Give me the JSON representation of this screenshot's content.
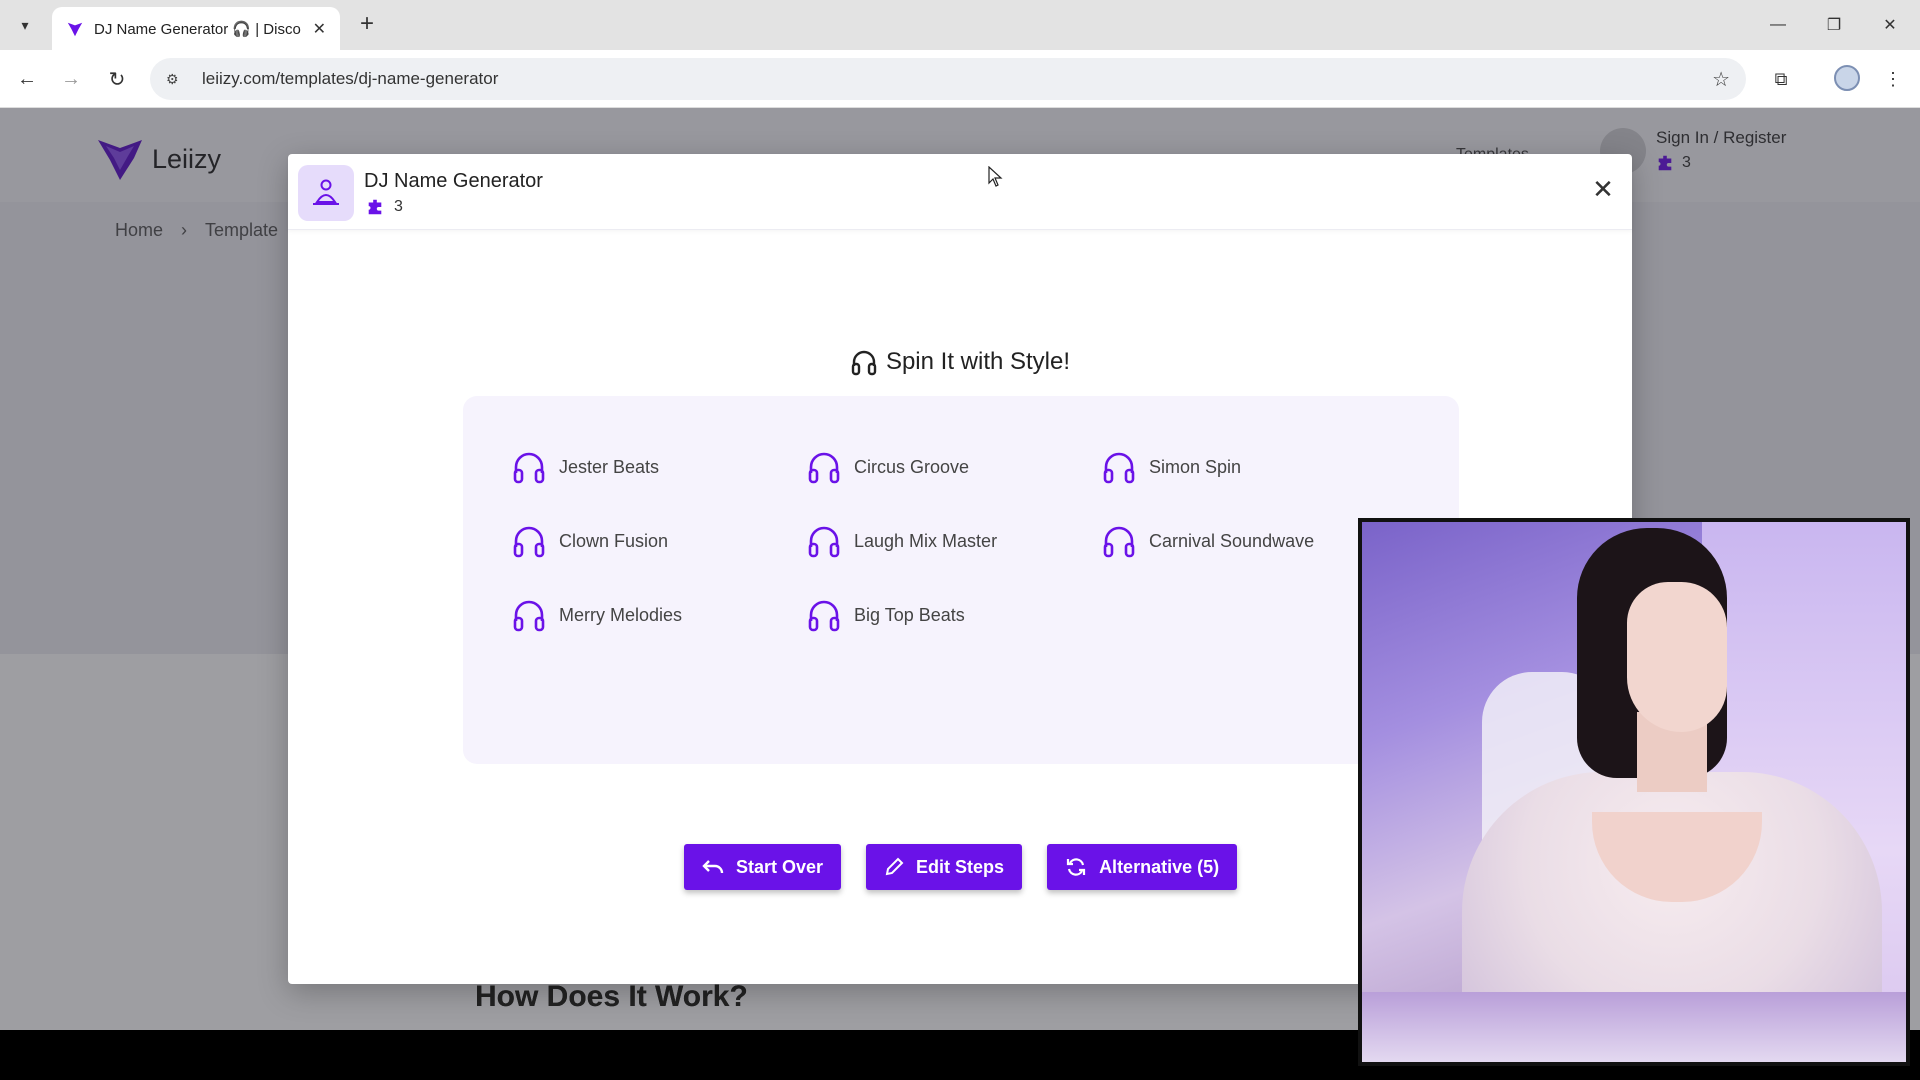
{
  "browser": {
    "tab_title": "DJ Name Generator 🎧 | Disco",
    "url": "leiizy.com/templates/dj-name-generator",
    "new_tab_symbol": "+"
  },
  "page": {
    "brand_name": "Leiizy",
    "nav_templates": "Templates",
    "signin_label": "Sign In / Register",
    "signin_credits": "3",
    "breadcrumb": [
      "Home",
      "Template"
    ],
    "how_title": "How Does It Work?"
  },
  "modal": {
    "title": "DJ Name Generator",
    "credits": "3",
    "heading": "Spin It with Style!",
    "names": [
      "Jester Beats",
      "Circus Groove",
      "Simon Spin",
      "Clown Fusion",
      "Laugh Mix Master",
      "Carnival Soundwave",
      "Merry Melodies",
      "Big Top Beats"
    ],
    "buttons": {
      "start_over": "Start Over",
      "edit_steps": "Edit Steps",
      "alternative": "Alternative (5)"
    }
  },
  "colors": {
    "accent": "#6a12e8",
    "result_bg": "#f6f3fd",
    "icon_bg": "#e6dcfb"
  }
}
